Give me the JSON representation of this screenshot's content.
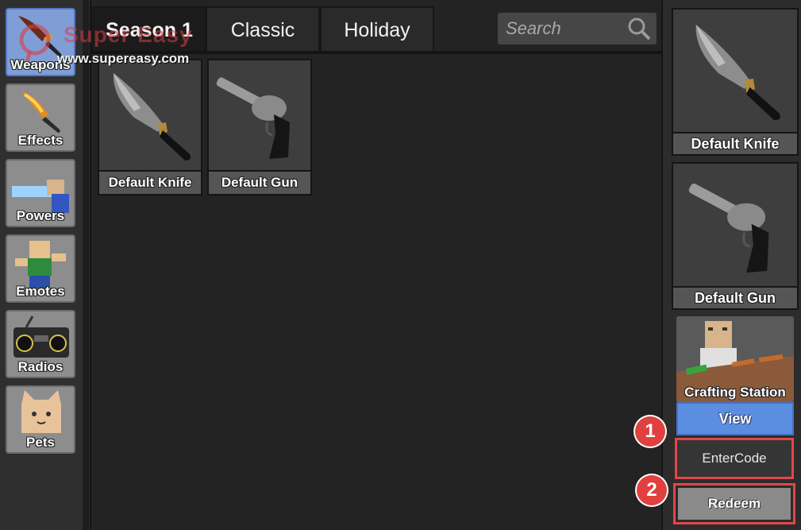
{
  "watermark": {
    "title": "Super Easy",
    "url": "www.supereasy.com"
  },
  "sidebar": {
    "items": [
      {
        "label": "Weapons",
        "icon": "knife-icon",
        "active": true
      },
      {
        "label": "Effects",
        "icon": "flame-knife-icon",
        "active": false
      },
      {
        "label": "Powers",
        "icon": "powers-icon",
        "active": false
      },
      {
        "label": "Emotes",
        "icon": "emote-icon",
        "active": false
      },
      {
        "label": "Radios",
        "icon": "radio-icon",
        "active": false
      },
      {
        "label": "Pets",
        "icon": "cat-icon",
        "active": false
      }
    ]
  },
  "tabs": [
    {
      "label": "Season 1",
      "active": true
    },
    {
      "label": "Classic",
      "active": false
    },
    {
      "label": "Holiday",
      "active": false
    }
  ],
  "search": {
    "placeholder": "Search",
    "value": ""
  },
  "inventory": {
    "items": [
      {
        "label": "Default Knife",
        "icon": "knife-icon"
      },
      {
        "label": "Default Gun",
        "icon": "revolver-icon"
      }
    ]
  },
  "equipped": {
    "knife": {
      "label": "Default Knife"
    },
    "gun": {
      "label": "Default Gun"
    }
  },
  "crafting": {
    "label": "Crafting Station",
    "view_label": "View"
  },
  "code": {
    "placeholder": "EnterCode",
    "redeem_label": "Redeem"
  },
  "annotations": {
    "step1": "1",
    "step2": "2"
  },
  "colors": {
    "accent_blue": "#5b8de0",
    "highlight_red": "#e0474a"
  }
}
